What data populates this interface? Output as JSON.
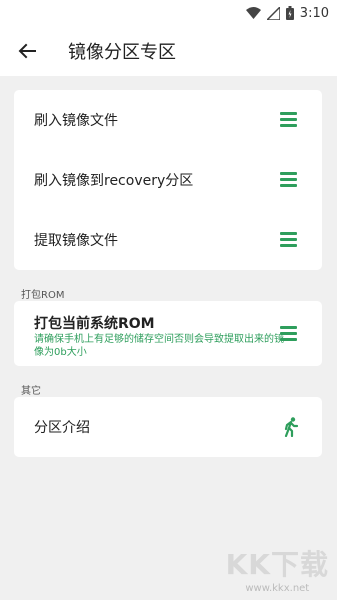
{
  "status_bar": {
    "time": "3:10",
    "icons": [
      "wifi-icon",
      "signal-icon",
      "battery-icon"
    ]
  },
  "header": {
    "title": "镜像分区专区",
    "back_icon": "arrow-left-icon"
  },
  "main_card": {
    "items": [
      {
        "label": "刷入镜像文件",
        "icon": "menu-icon"
      },
      {
        "label": "刷入镜像到recovery分区",
        "icon": "menu-icon"
      },
      {
        "label": "提取镜像文件",
        "icon": "menu-icon"
      }
    ]
  },
  "rom_section": {
    "label": "打包ROM",
    "item": {
      "title": "打包当前系统ROM",
      "description": "请确保手机上有足够的储存空间否则会导致提取出来的镜像为0b大小",
      "icon": "menu-icon"
    }
  },
  "other_section": {
    "label": "其它",
    "item": {
      "label": "分区介绍",
      "icon": "running-person-icon"
    }
  },
  "watermark": {
    "logo": "KK下载",
    "url": "www.kkx.net"
  },
  "colors": {
    "accent": "#2e9e5c",
    "background": "#f0f0f0",
    "card": "#ffffff"
  }
}
